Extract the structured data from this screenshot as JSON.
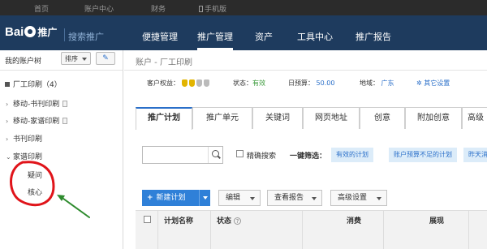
{
  "top_nav": [
    "首页",
    "账户中心",
    "财务",
    "手机版"
  ],
  "brand": {
    "logo_left": "Bai",
    "logo_right": "推广",
    "sub": "搜索推广"
  },
  "main_nav": [
    "便捷管理",
    "推广管理",
    "资产",
    "工具中心",
    "推广报告"
  ],
  "sidebar": {
    "title": "我的账户树",
    "sort_label": "排序",
    "account": "厂工印刷（4）",
    "items": [
      "移动-书刊印刷",
      "移动-家谱印刷",
      "书刊印刷",
      "家谱印刷"
    ],
    "subitems": [
      "疑问",
      "核心"
    ]
  },
  "breadcrumb": "账户 - 厂工印刷",
  "info": {
    "balance_label": "客户权益：",
    "status_label": "状态：",
    "status_value": "有效",
    "budget_label": "日预算：",
    "budget_value": "50.00",
    "region_label": "地域：",
    "region_value": "广东",
    "other_settings": "其它设置"
  },
  "tabs": [
    "推广计划",
    "推广单元",
    "关键词",
    "网页地址",
    "创意",
    "附加创意",
    "高级"
  ],
  "filter": {
    "exact_search": "精确搜索",
    "one_click_label": "一键筛选：",
    "chips": [
      "有效的计划",
      "账户预算不足的计划",
      "昨天消"
    ]
  },
  "toolbar": {
    "new_plan": "新建计划",
    "edit": "编辑",
    "view_report": "查看报告",
    "advanced": "高级设置"
  },
  "table_headers": {
    "plan_name": "计划名称",
    "status": "状态",
    "spend": "消费",
    "impressions": "展现"
  },
  "colors": {
    "header_bg": "#1e3b5e",
    "topbar_bg": "#2b2b2b",
    "accent": "#2a6fc9",
    "annotation_red": "#e0141a",
    "annotation_green": "#2e8b2e"
  }
}
